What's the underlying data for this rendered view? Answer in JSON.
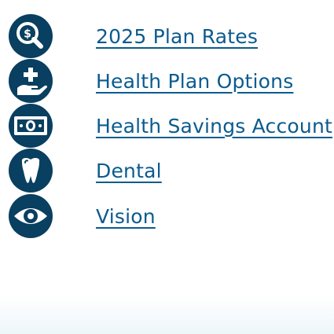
{
  "colors": {
    "icon_fill": "#093f60",
    "link": "#0b5b8f"
  },
  "links": [
    {
      "label": "2025 Plan Rates",
      "icon": "money-search-icon"
    },
    {
      "label": "Health Plan Options",
      "icon": "medical-hand-icon"
    },
    {
      "label": "Health Savings Account",
      "icon": "money-bill-icon"
    },
    {
      "label": "Dental",
      "icon": "tooth-icon"
    },
    {
      "label": "Vision",
      "icon": "eye-icon"
    }
  ]
}
